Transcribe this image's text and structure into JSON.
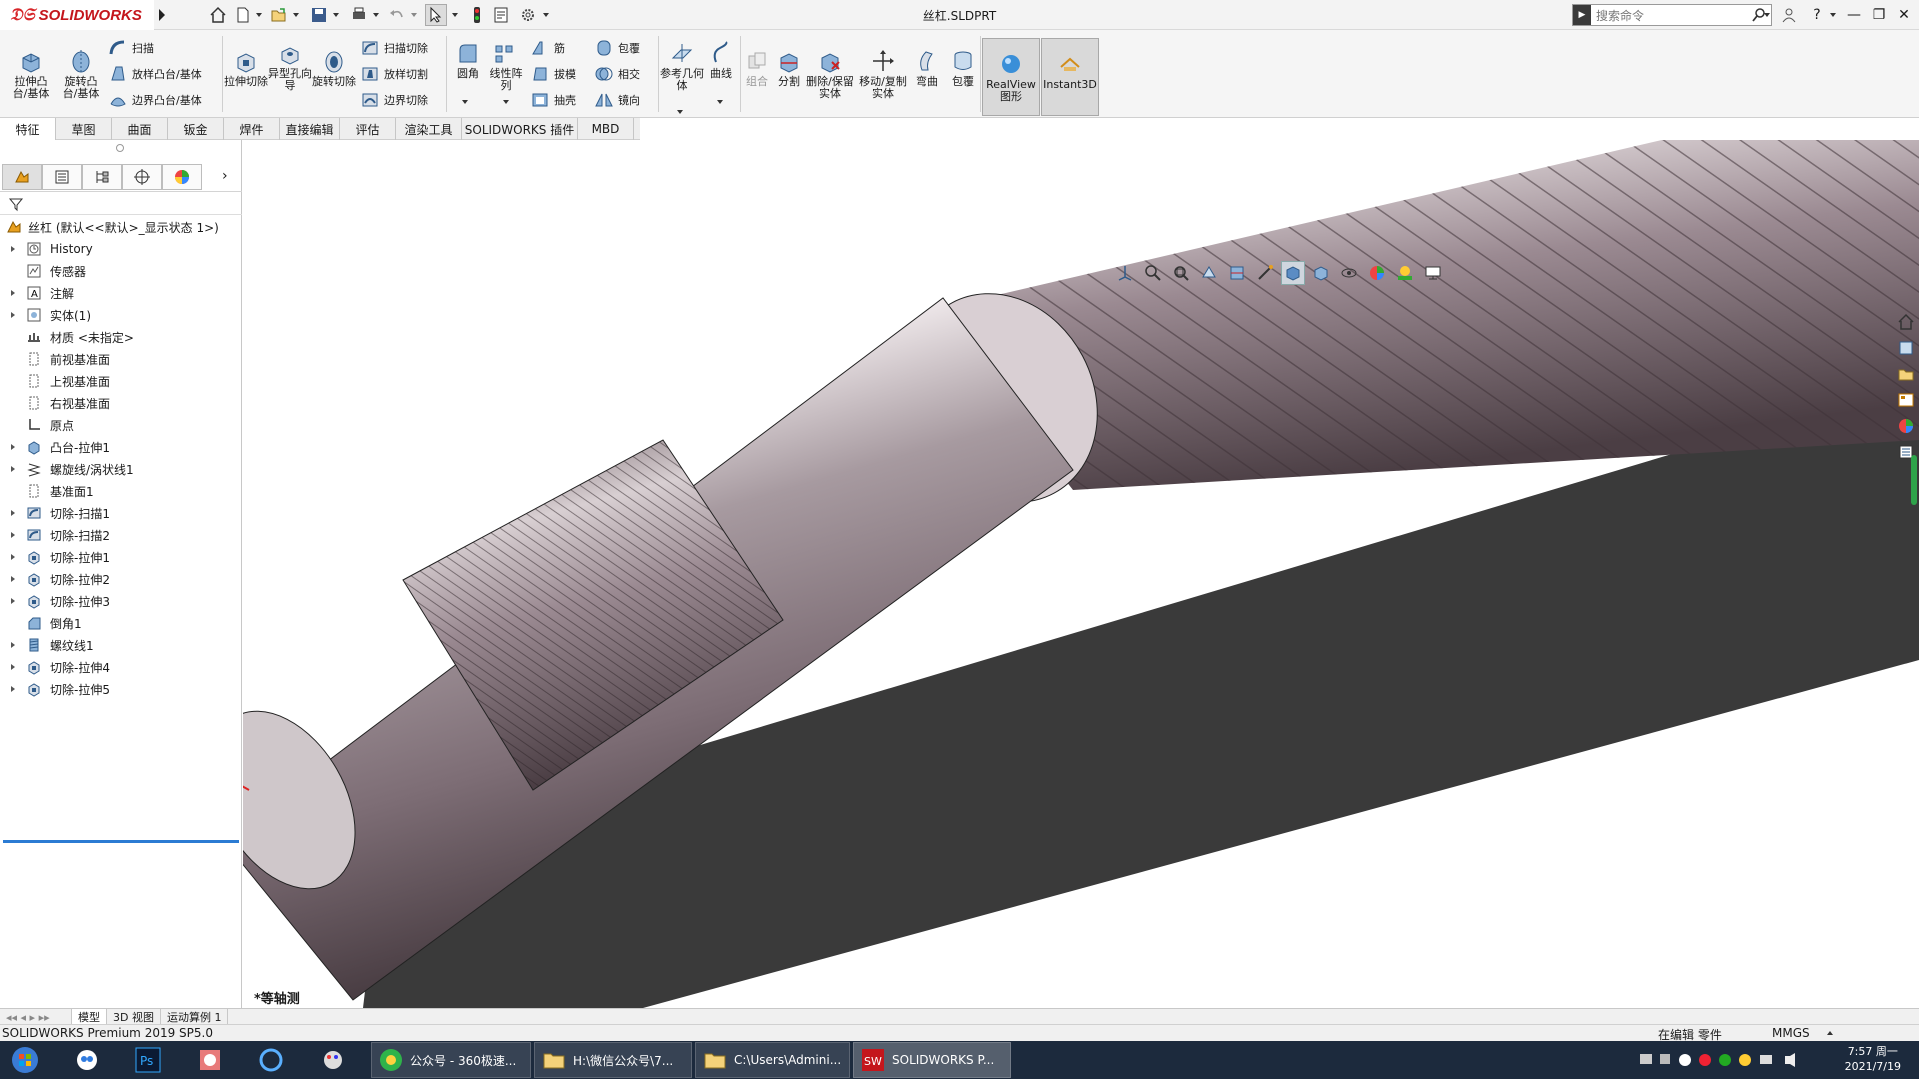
{
  "app": {
    "brand": "SOLIDWORKS",
    "window_title": "丝杠.SLDPRT"
  },
  "search": {
    "placeholder": "搜索命令"
  },
  "ribbon": {
    "extrude_boss": "拉伸凸台/基体",
    "revolve_boss": "旋转凸台/基体",
    "sweep": "扫描",
    "loft": "放样凸台/基体",
    "boundary": "边界凸台/基体",
    "extrude_cut": "拉伸切除",
    "hole_wizard": "异型孔向导",
    "revolve_cut": "旋转切除",
    "swept_cut": "扫描切除",
    "lofted_cut": "放样切割",
    "boundary_cut": "边界切除",
    "fillet": "圆角",
    "linear_pattern": "线性阵列",
    "rib": "筋",
    "draft": "拔模",
    "shell": "抽壳",
    "wrap": "包覆",
    "intersect": "相交",
    "mirror": "镜向",
    "ref_geometry": "参考几何体",
    "curves": "曲线",
    "combine": "组合",
    "split": "分割",
    "delete_body": "删除/保留实体",
    "move_copy": "移动/复制实体",
    "flex": "弯曲",
    "wrap2": "包覆",
    "realview": "RealView图形",
    "instant3d": "Instant3D"
  },
  "tabs": [
    "特征",
    "草图",
    "曲面",
    "钣金",
    "焊件",
    "直接编辑",
    "评估",
    "渲染工具",
    "SOLIDWORKS 插件",
    "MBD"
  ],
  "tree": {
    "root": "丝杠 (默认<<默认>_显示状态 1>)",
    "items": [
      "History",
      "传感器",
      "注解",
      "实体(1)",
      "材质 <未指定>",
      "前视基准面",
      "上视基准面",
      "右视基准面",
      "原点",
      "凸台-拉伸1",
      "螺旋线/涡状线1",
      "基准面1",
      "切除-扫描1",
      "切除-扫描2",
      "切除-拉伸1",
      "切除-拉伸2",
      "切除-拉伸3",
      "倒角1",
      "螺纹线1",
      "切除-拉伸4",
      "切除-拉伸5"
    ]
  },
  "viewport": {
    "view_label": "*等轴测"
  },
  "bottom_tabs": [
    "模型",
    "3D 视图",
    "运动算例 1"
  ],
  "status": {
    "product": "SOLIDWORKS Premium 2019 SP5.0",
    "mode": "在编辑 零件",
    "units": "MMGS"
  },
  "taskbar": {
    "apps": [
      "公众号 - 360极速...",
      "H:\\微信公众号\\7...",
      "C:\\Users\\Admini...",
      "SOLIDWORKS P..."
    ],
    "time": "7:57 周一",
    "date": "2021/7/19"
  },
  "colors": {
    "accent": "#2b7bd3",
    "brand_red": "#d7262a",
    "metal": "#b8a8b0"
  }
}
